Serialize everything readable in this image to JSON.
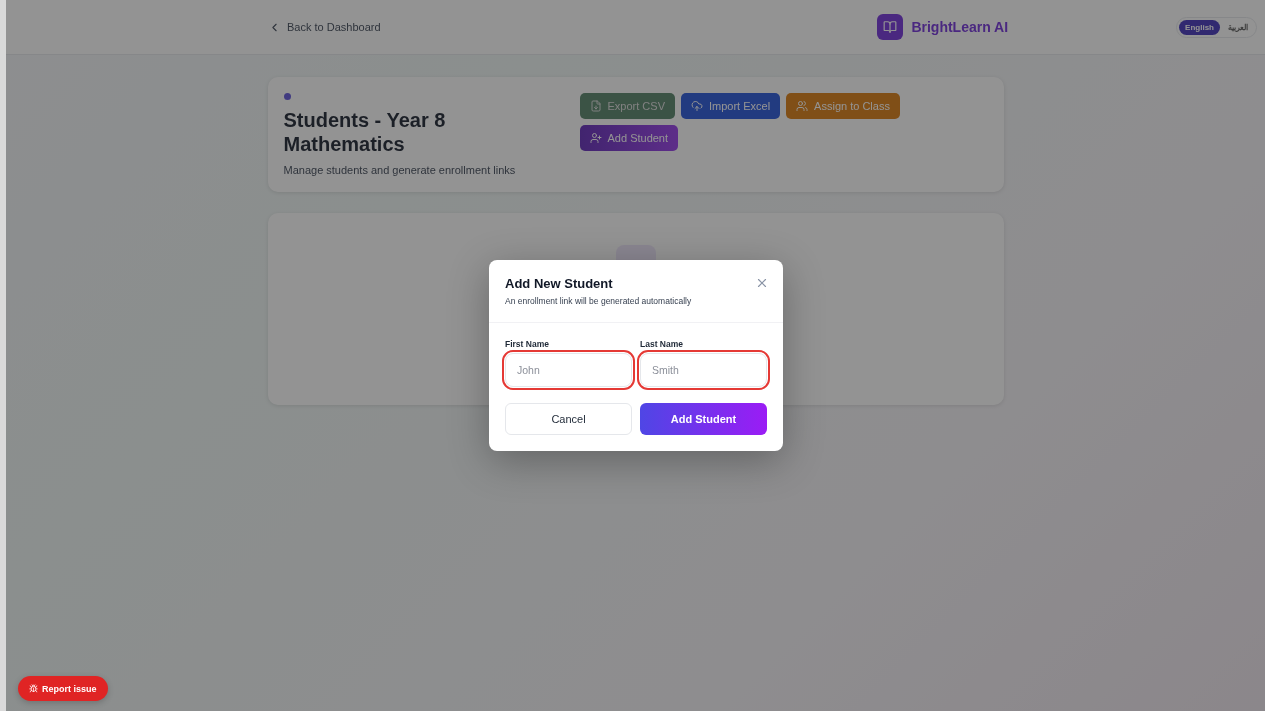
{
  "header": {
    "back_link": "Back to Dashboard",
    "brand": "BrightLearn AI",
    "languages": [
      {
        "label": "English",
        "selected": true
      },
      {
        "label": "العربية",
        "selected": false
      }
    ]
  },
  "page_header": {
    "title": "Students - Year 8 Mathematics",
    "subtitle": "Manage students and generate enrollment links",
    "actions": [
      {
        "kind": "export",
        "label": "Export CSV",
        "disabled": true
      },
      {
        "kind": "import",
        "label": "Import Excel",
        "disabled": false
      },
      {
        "kind": "assign",
        "label": "Assign to Class",
        "disabled": false
      },
      {
        "kind": "add",
        "label": "Add Student",
        "disabled": false
      }
    ]
  },
  "dialog": {
    "title": "Add New Student",
    "subtitle": "An enrollment link will be generated automatically",
    "fields": [
      {
        "label": "First Name",
        "placeholder": "John",
        "error": true
      },
      {
        "label": "Last Name",
        "placeholder": "Smith",
        "error": true
      }
    ],
    "cancel": "Cancel",
    "submit": "Add Student"
  },
  "report_button": "Report issue"
}
